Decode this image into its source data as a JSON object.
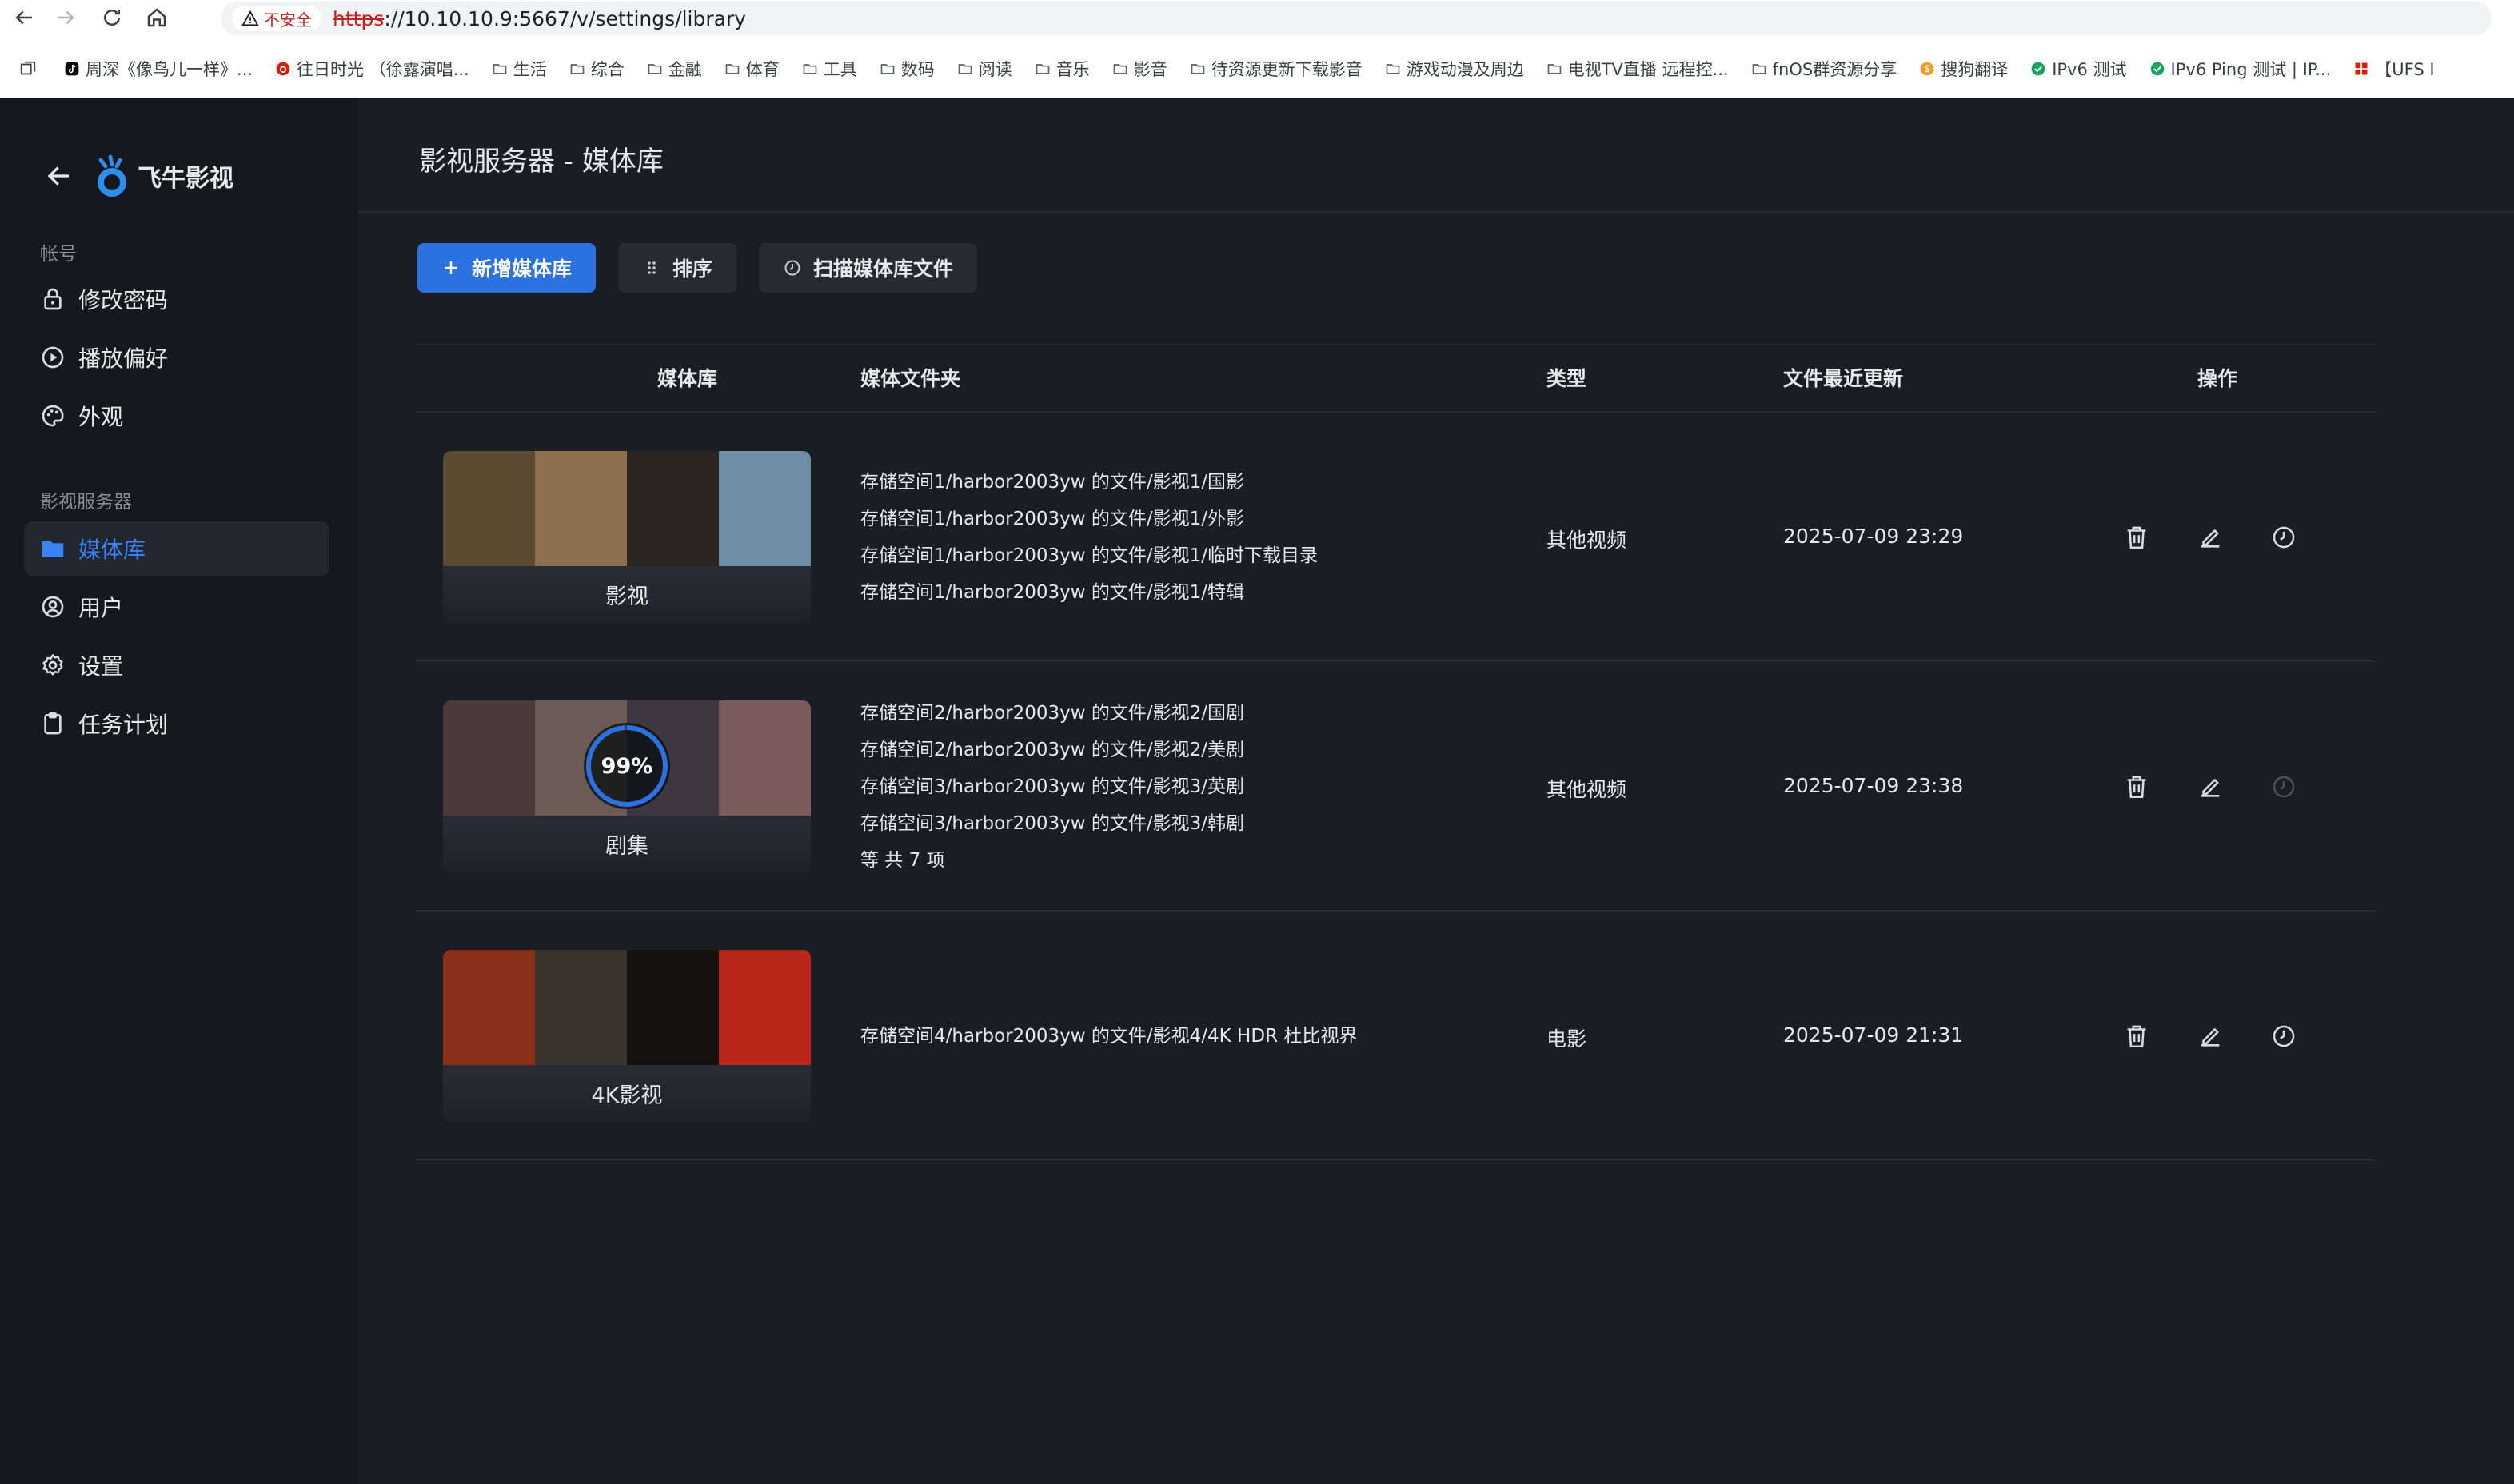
{
  "browser": {
    "insecure_label": "不安全",
    "url_https": "https",
    "url_rest": "://10.10.10.9:5667/v/settings/library",
    "bookmarks": [
      {
        "label": "周深《像鸟儿一样》...",
        "icon": "tiktok-icon",
        "color": "#000000"
      },
      {
        "label": "往日时光 （徐露演唱...",
        "icon": "netease-icon",
        "color": "#d81e06"
      },
      {
        "label": "生活",
        "icon": "folder-icon"
      },
      {
        "label": "综合",
        "icon": "folder-icon"
      },
      {
        "label": "金融",
        "icon": "folder-icon"
      },
      {
        "label": "体育",
        "icon": "folder-icon"
      },
      {
        "label": "工具",
        "icon": "folder-icon"
      },
      {
        "label": "数码",
        "icon": "folder-icon"
      },
      {
        "label": "阅读",
        "icon": "folder-icon"
      },
      {
        "label": "音乐",
        "icon": "folder-icon"
      },
      {
        "label": "影音",
        "icon": "folder-icon"
      },
      {
        "label": "待资源更新下载影音",
        "icon": "folder-icon"
      },
      {
        "label": "游戏动漫及周边",
        "icon": "folder-icon"
      },
      {
        "label": "电视TV直播 远程控...",
        "icon": "folder-icon"
      },
      {
        "label": "fnOS群资源分享",
        "icon": "folder-icon"
      },
      {
        "label": "搜狗翻译",
        "icon": "sogou-icon",
        "color": "#f39b2b"
      },
      {
        "label": "IPv6 测试",
        "icon": "check-circle-icon",
        "color": "#1aa260"
      },
      {
        "label": "IPv6 Ping 测试 | IP...",
        "icon": "check-circle-icon",
        "color": "#1aa260"
      },
      {
        "label": "【UFS I",
        "icon": "grid-icon",
        "color": "#d81e06"
      }
    ]
  },
  "sidebar": {
    "app_name": "飞牛影视",
    "section_account": "帐号",
    "account_items": [
      {
        "label": "修改密码",
        "icon": "lock-icon"
      },
      {
        "label": "播放偏好",
        "icon": "play-circle-icon"
      },
      {
        "label": "外观",
        "icon": "palette-icon"
      }
    ],
    "section_server": "影视服务器",
    "server_items": [
      {
        "label": "媒体库",
        "icon": "folder-icon",
        "active": true
      },
      {
        "label": "用户",
        "icon": "user-circle-icon"
      },
      {
        "label": "设置",
        "icon": "gear-icon"
      },
      {
        "label": "任务计划",
        "icon": "clipboard-icon"
      }
    ]
  },
  "main": {
    "title": "影视服务器 - 媒体库",
    "toolbar": {
      "add_label": "新增媒体库",
      "sort_label": "排序",
      "scan_label": "扫描媒体库文件"
    },
    "columns": [
      "媒体库",
      "媒体文件夹",
      "类型",
      "文件最近更新",
      "操作"
    ],
    "libraries": [
      {
        "name": "影视",
        "folders": [
          "存储空间1/harbor2003yw 的文件/影视1/国影",
          "存储空间1/harbor2003yw 的文件/影视1/外影",
          "存储空间1/harbor2003yw 的文件/影视1/临时下载目录",
          "存储空间1/harbor2003yw 的文件/影视1/特辑"
        ],
        "type": "其他视频",
        "updated": "2025-07-09 23:29",
        "scanning": false,
        "thumb_colors": [
          "#5a4a32",
          "#8b6f4e",
          "#2d2620",
          "#6f8fa6"
        ]
      },
      {
        "name": "剧集",
        "folders": [
          "存储空间2/harbor2003yw 的文件/影视2/国剧",
          "存储空间2/harbor2003yw 的文件/影视2/美剧",
          "存储空间3/harbor2003yw 的文件/影视3/英剧",
          "存储空间3/harbor2003yw 的文件/影视3/韩剧",
          "等 共 7 项"
        ],
        "type": "其他视频",
        "updated": "2025-07-09 23:38",
        "scanning": true,
        "progress": "99%",
        "progress_value": 99,
        "thumb_colors": [
          "#4a3a3a",
          "#6b5a55",
          "#3e3640",
          "#7a5a5a"
        ]
      },
      {
        "name": "4K影视",
        "folders": [
          "存储空间4/harbor2003yw 的文件/影视4/4K HDR 杜比视界"
        ],
        "type": "电影",
        "updated": "2025-07-09 21:31",
        "scanning": false,
        "thumb_colors": [
          "#8a2f18",
          "#3a342a",
          "#15120f",
          "#b8281a"
        ]
      }
    ]
  },
  "colors": {
    "accent": "#2b71e0",
    "active_nav": "#3b82f6",
    "background": "#1a1d24",
    "sidebar": "#16181d"
  }
}
